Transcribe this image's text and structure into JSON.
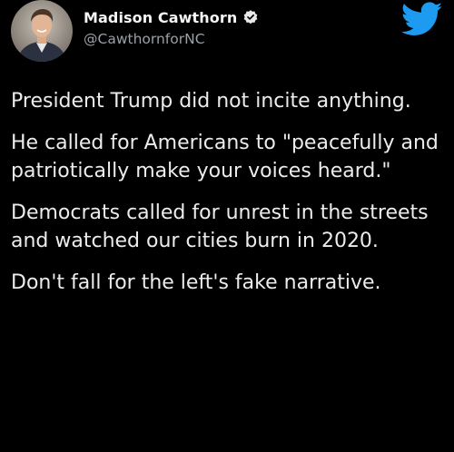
{
  "tweet": {
    "author": {
      "display_name": "Madison Cawthorn",
      "handle": "@CawthornforNC",
      "verified_icon": "verified-badge-icon",
      "avatar_icon": "profile-avatar"
    },
    "brand_icon": "twitter-bird-icon",
    "paragraphs": [
      "President Trump did not incite anything.",
      "He called for Americans to \"peacefully and patriotically make your voices heard.\"",
      "Democrats called for unrest in the streets and watched our cities burn in 2020.",
      "Don't fall for the left's fake narrative."
    ]
  },
  "colors": {
    "background": "#000000",
    "text": "#ececec",
    "handle": "#9aa0a6",
    "twitter_blue": "#1d9bf0"
  }
}
